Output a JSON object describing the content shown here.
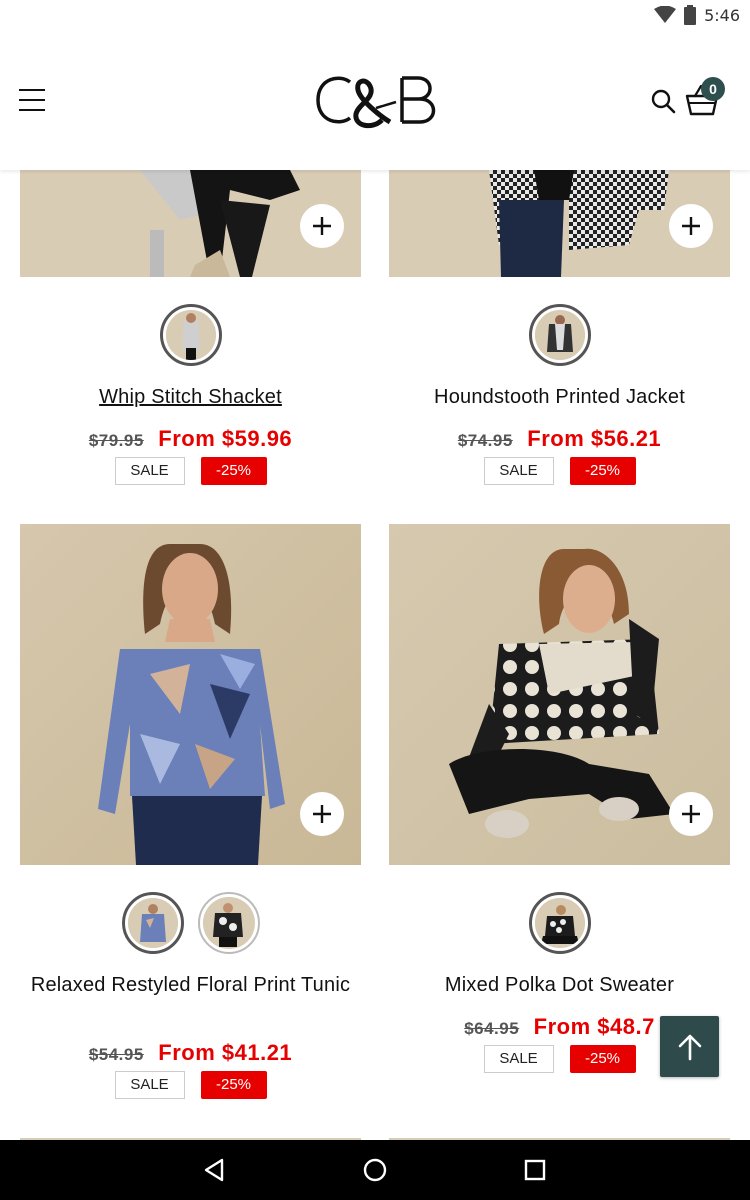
{
  "status_bar": {
    "time": "5:46",
    "icons": [
      "wifi-icon",
      "battery-icon"
    ]
  },
  "header": {
    "brand": "C&B",
    "menu_icon": "hamburger-menu-icon",
    "search_icon": "search-icon",
    "cart_icon": "shopping-basket-icon",
    "cart_count": "0"
  },
  "products": [
    {
      "name": "Whip Stitch Shacket",
      "old_price": "$79.95",
      "new_price": "From $59.96",
      "sale_label": "SALE",
      "discount": "-25%",
      "swatches": 1
    },
    {
      "name": "Houndstooth Printed Jacket",
      "old_price": "$74.95",
      "new_price": "From $56.21",
      "sale_label": "SALE",
      "discount": "-25%",
      "swatches": 1
    },
    {
      "name": "Relaxed Restyled Floral Print Tunic",
      "old_price": "$54.95",
      "new_price": "From $41.21",
      "sale_label": "SALE",
      "discount": "-25%",
      "swatches": 2
    },
    {
      "name": "Mixed Polka Dot Sweater",
      "old_price": "$64.95",
      "new_price": "From $48.7",
      "sale_label": "SALE",
      "discount": "-25%",
      "swatches": 1
    }
  ],
  "colors": {
    "sale_red": "#e60000",
    "accent_teal": "#2e4a4a",
    "photo_background": "#d9ccb4"
  },
  "nav_bar": {
    "icons": [
      "back-icon",
      "home-icon",
      "recents-icon"
    ]
  }
}
